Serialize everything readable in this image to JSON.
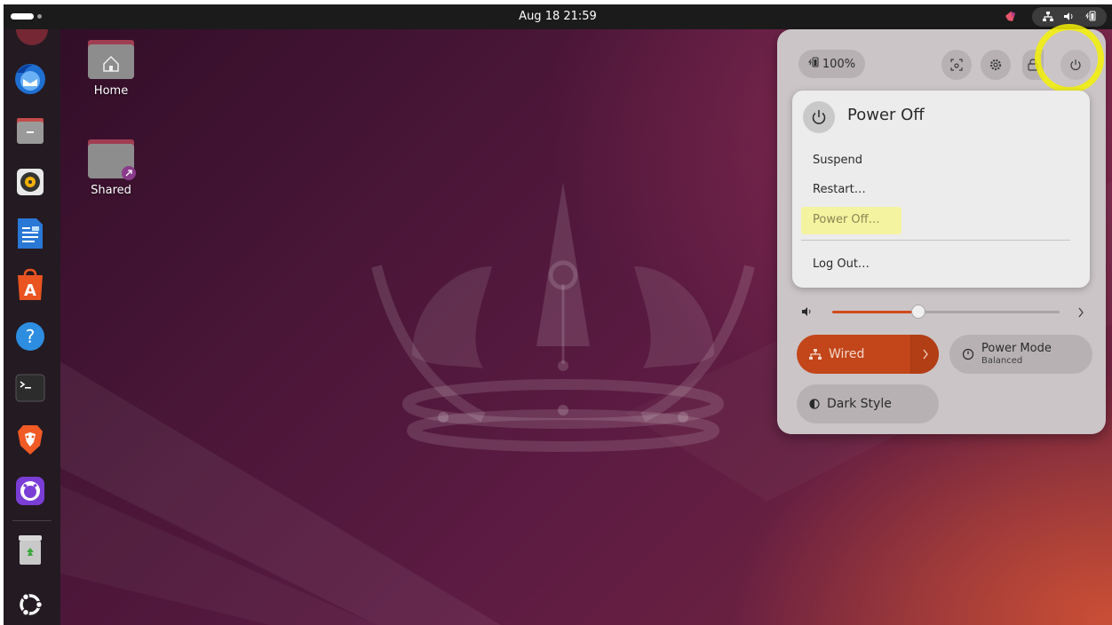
{
  "topbar": {
    "clock": "Aug 18  21:59"
  },
  "dock": {
    "apps": [
      "Thunderbird",
      "Files",
      "Rhythmbox",
      "LibreOffice Writer",
      "App Center",
      "Help",
      "Terminal",
      "Brave",
      "GitHub Desktop",
      "Trash",
      "Show Apps"
    ]
  },
  "desktop": {
    "icons": [
      {
        "label": "Home"
      },
      {
        "label": "Shared"
      }
    ]
  },
  "quick_settings": {
    "battery_label": "100%",
    "power_menu": {
      "title": "Power Off",
      "items": [
        "Suspend",
        "Restart…",
        "Power Off…",
        "Log Out…"
      ]
    },
    "volume_level": 0.38,
    "wired": {
      "label": "Wired"
    },
    "power_mode": {
      "label": "Power Mode",
      "value": "Balanced"
    },
    "dark_style": {
      "label": "Dark Style"
    }
  },
  "colors": {
    "accent": "#c2461a",
    "highlight": "#f4f106"
  }
}
